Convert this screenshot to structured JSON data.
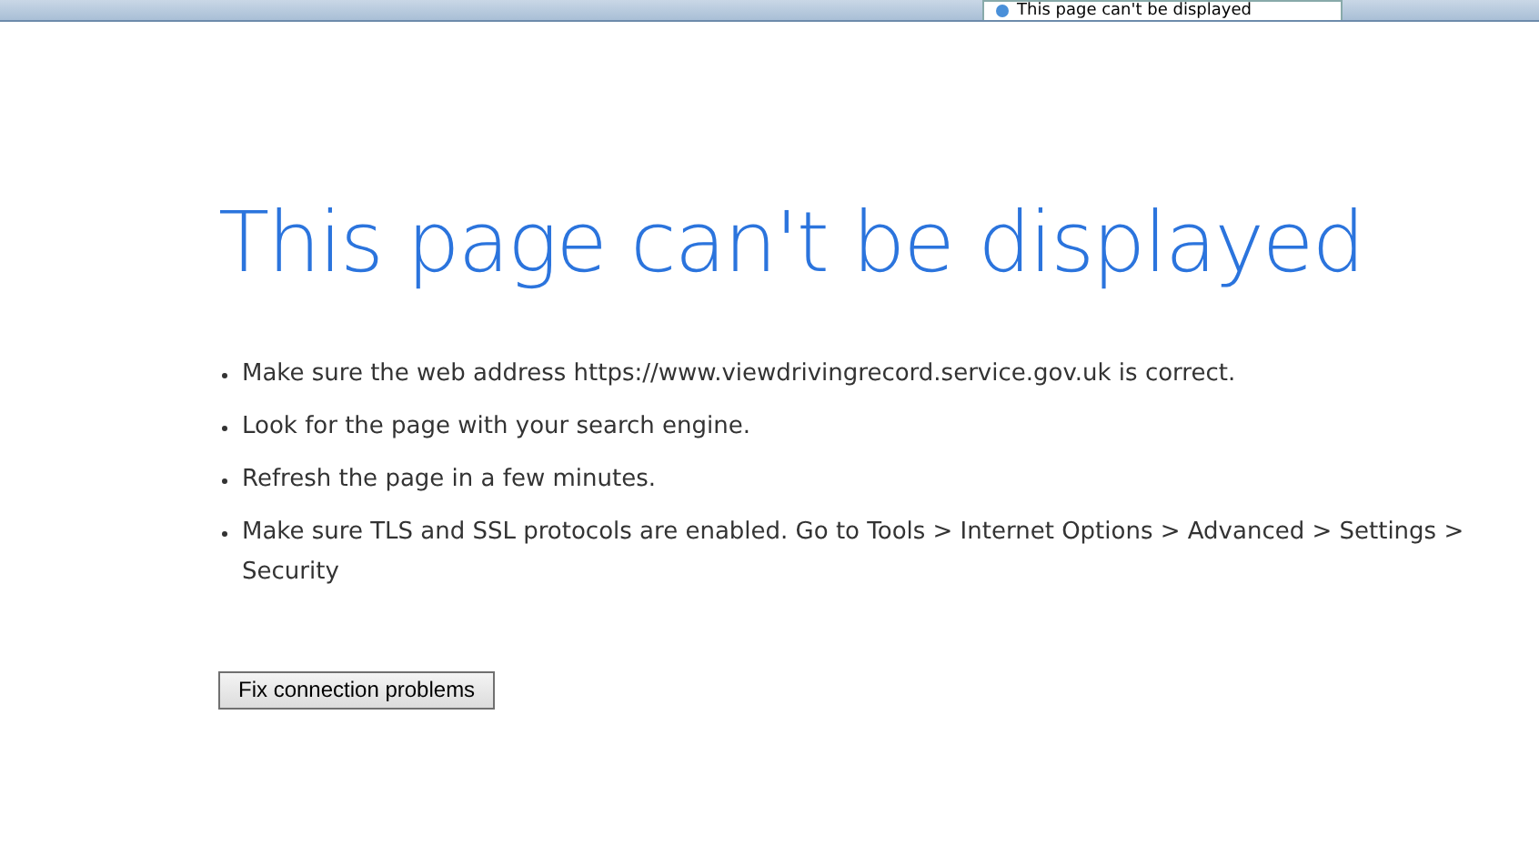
{
  "browser": {
    "tab_title": "This page can't be displayed"
  },
  "heading": "This page can't be displayed",
  "suggestions": [
    "Make sure the web address https://www.viewdrivingrecord.service.gov.uk is correct.",
    "Look for the page with your search engine.",
    "Refresh the page in a few minutes.",
    "Make sure TLS and SSL protocols are enabled. Go to Tools > Internet Options > Advanced > Settings > Security"
  ],
  "button": "Fix connection problems"
}
